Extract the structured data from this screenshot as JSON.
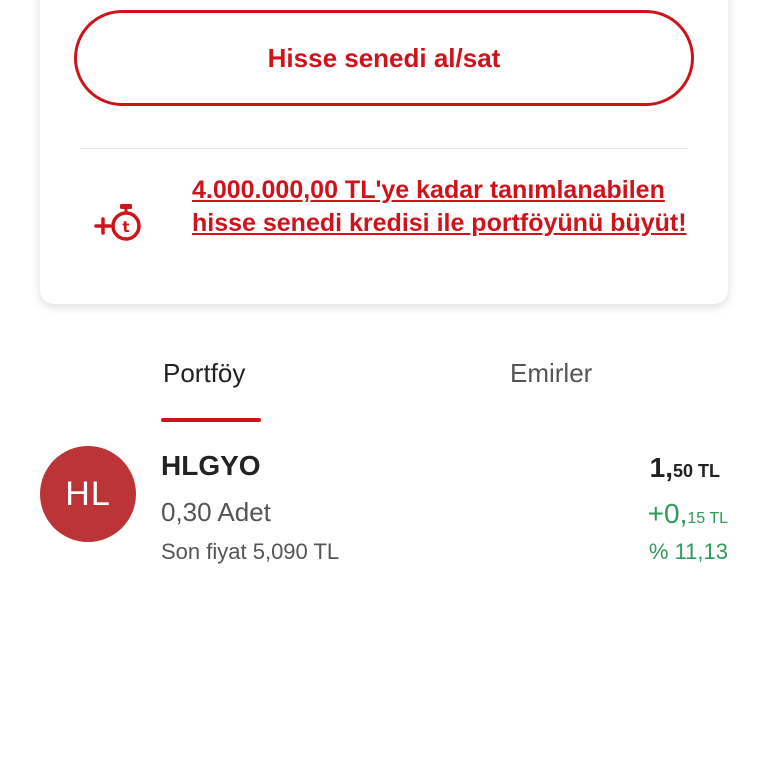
{
  "actions": {
    "trade_button_label": "Hisse senedi al/sat"
  },
  "promo": {
    "icon": "credit-stopwatch-icon",
    "text": "4.000.000,00 TL'ye kadar tanımlanabilen hisse senedi kredisi ile portföyünü büyüt!"
  },
  "tabs": [
    {
      "label": "Portföy",
      "active": true
    },
    {
      "label": "Emirler",
      "active": false
    }
  ],
  "holding": {
    "avatar_initials": "HL",
    "ticker": "HLGYO",
    "quantity": "0,30 Adet",
    "last_price": "Son fiyat 5,090 TL",
    "value_int": "1,",
    "value_dec": "50 TL",
    "change_int": "+0,",
    "change_dec": "15 TL",
    "change_pct": "% 11,13"
  },
  "colors": {
    "brand_red": "#d0121b",
    "avatar_bg": "#bd3438",
    "positive_green": "#2f9a5b"
  }
}
